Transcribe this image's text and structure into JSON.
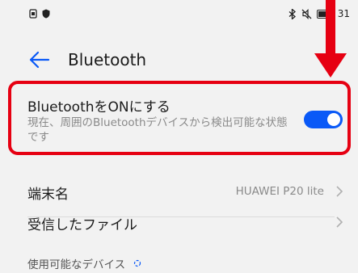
{
  "status_bar": {
    "time": "31",
    "icons": [
      "sim-icon",
      "shield-icon",
      "bluetooth-icon",
      "mute-icon",
      "battery-icon"
    ]
  },
  "header": {
    "title": "Bluetooth",
    "back_icon": "back-arrow-icon"
  },
  "bluetooth_toggle": {
    "title": "BluetoothをONにする",
    "description": "現在、周囲のBluetoothデバイスから検出可能な状態です",
    "enabled": true
  },
  "rows": [
    {
      "label": "端末名",
      "value": "HUAWEI P20 lite"
    },
    {
      "label": "受信したファイル",
      "value": ""
    }
  ],
  "section": {
    "available_devices": "使用可能なデバイス"
  },
  "colors": {
    "accent": "#0a59f7",
    "highlight": "#e60012",
    "background": "#f2f2f2"
  }
}
